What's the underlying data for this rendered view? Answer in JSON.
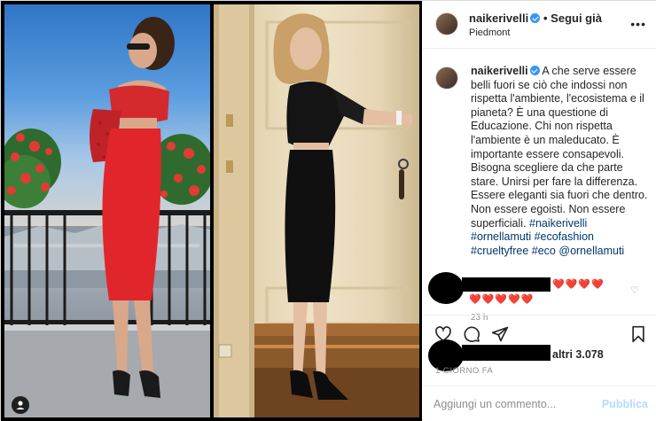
{
  "header": {
    "username": "naikerivelli",
    "follow_label": "Segui già",
    "location": "Piedmont",
    "more_icon": "more-horizontal-icon"
  },
  "caption": {
    "username": "naikerivelli",
    "text": "A che serve essere belli fuori se ciò che indossi non rispetta l'ambiente, l'ecosistema e il pianeta? È una questione di Educazione. Chi non rispetta l'ambiente è un maleducato. È importante essere consapevoli. Bisogna scegliere da che parte stare. Unirsi per fare la differenza. Essere eleganti sia fuori che dentro. Non essere egoisti. Non essere superficiali.",
    "hashtags": "#naikerivelli #ornellamuti #ecofashion #crueltyfree #eco",
    "mention": "@ornellamuti",
    "time": "23 h"
  },
  "comment": {
    "hearts_line1": "❤️❤️❤️❤️",
    "hearts_line2": "❤️❤️❤️❤️❤️"
  },
  "likes": {
    "text": "altri 3.078",
    "time": "1 GIORNO FA"
  },
  "add_comment": {
    "placeholder": "Aggiungi un commento...",
    "publish_label": "Pubblica"
  },
  "colors": {
    "link": "#00376b",
    "verified": "#3897f0",
    "publish_disabled": "#b3dbff",
    "dress_red": "#e0262b"
  }
}
